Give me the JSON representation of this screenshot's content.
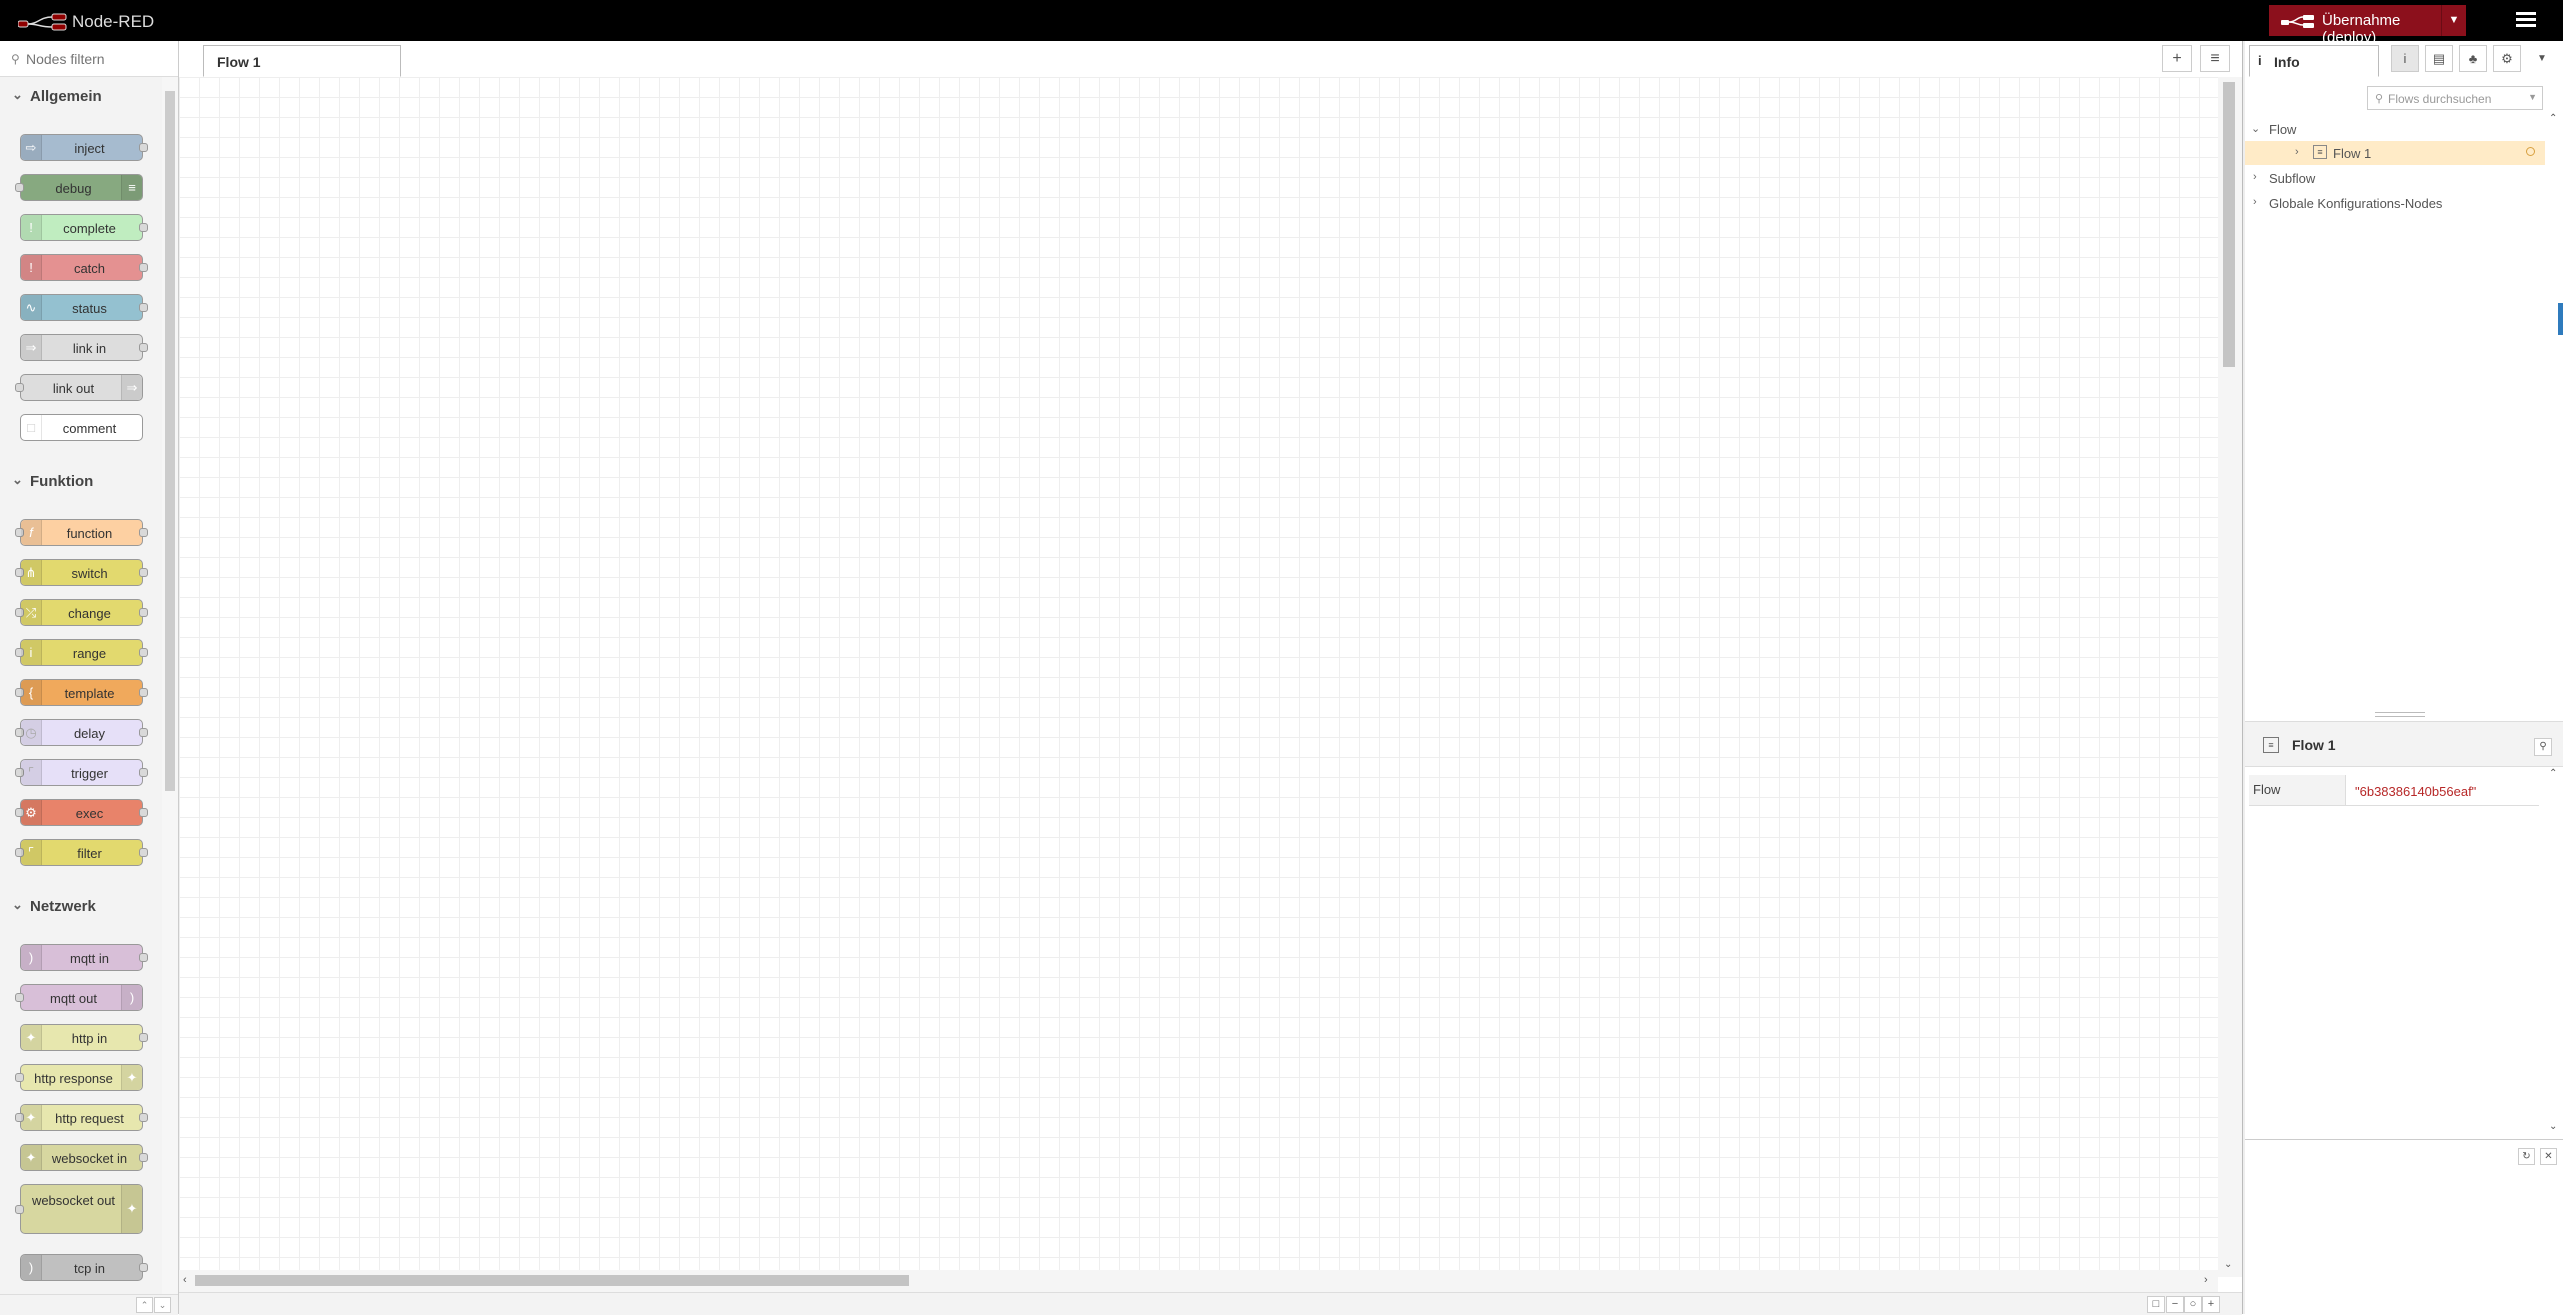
{
  "header": {
    "title": "Node-RED",
    "deploy_label": "Übernahme (deploy)"
  },
  "palette": {
    "search_placeholder": "Nodes filtern",
    "categories": [
      {
        "label": "Allgemein",
        "nodes": [
          "inject",
          "debug",
          "complete",
          "catch",
          "status",
          "link in",
          "link out",
          "comment"
        ]
      },
      {
        "label": "Funktion",
        "nodes": [
          "function",
          "switch",
          "change",
          "range",
          "template",
          "delay",
          "trigger",
          "exec",
          "filter"
        ]
      },
      {
        "label": "Netzwerk",
        "nodes": [
          "mqtt in",
          "mqtt out",
          "http in",
          "http response",
          "http request",
          "websocket in",
          "websocket out",
          "tcp in"
        ]
      }
    ]
  },
  "workspace": {
    "tab_label": "Flow 1"
  },
  "sidebar": {
    "tab_label": "Info",
    "search_placeholder": "Flows durchsuchen",
    "tree": {
      "flow": "Flow",
      "flow_item": "Flow 1",
      "subflow": "Subflow",
      "global": "Globale Konfigurations-Nodes"
    },
    "details": {
      "title": "Flow 1",
      "prop_key": "Flow",
      "prop_value": "\"6b38386140b56eaf\""
    }
  },
  "colors": {
    "header_bg": "#000000",
    "deploy_bg": "#8c101c",
    "selected_row": "#ffebc7",
    "id_value": "#b72828"
  }
}
